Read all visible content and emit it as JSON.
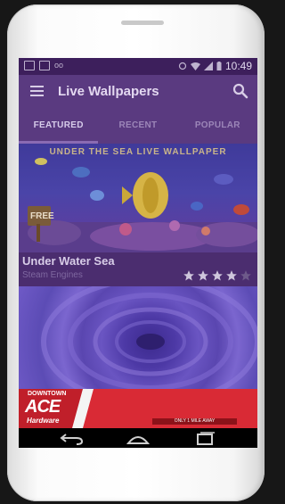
{
  "status_bar": {
    "time": "10:49"
  },
  "toolbar": {
    "title": "Live Wallpapers",
    "menu_icon": "menu-icon",
    "search_icon": "search-icon"
  },
  "tabs": [
    {
      "label": "FEATURED",
      "active": true
    },
    {
      "label": "RECENT",
      "active": false
    },
    {
      "label": "POPULAR",
      "active": false
    }
  ],
  "wallpapers": [
    {
      "banner_text": "UNDER THE SEA LIVE WALLPAPER",
      "badge": "FREE",
      "title": "Under Water Sea",
      "developer": "Steam Engines",
      "rating": 4,
      "max_rating": 5
    }
  ],
  "ad": {
    "tagline": "DOWNTOWN",
    "brand": "ACE",
    "brand_sub": "Hardware",
    "strip_text": "ONLY 1 MILE AWAY",
    "colors": {
      "background": "#d92a35"
    }
  },
  "nav_bar": {
    "icons": [
      "back-icon",
      "home-icon",
      "recents-icon"
    ]
  },
  "colors": {
    "screen_tint": "#4b2d6f",
    "toolbar": "#5a3a80",
    "accent": "#8a6bb3"
  }
}
